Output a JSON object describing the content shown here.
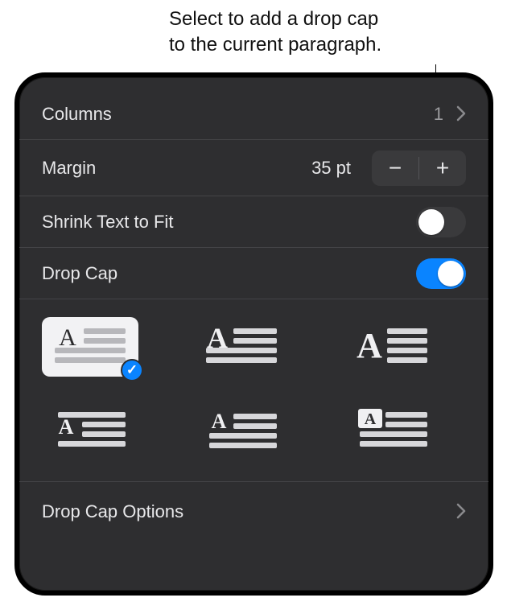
{
  "callout": {
    "line1": "Select to add a drop cap",
    "line2": "to the current paragraph."
  },
  "panel": {
    "columns": {
      "label": "Columns",
      "value": "1"
    },
    "margin": {
      "label": "Margin",
      "value": "35 pt",
      "decrease_glyph": "−",
      "increase_glyph": "+"
    },
    "shrink": {
      "label": "Shrink Text to Fit",
      "enabled": false
    },
    "dropcap": {
      "label": "Drop Cap",
      "enabled": true
    },
    "styles": {
      "selected_index": 0,
      "items": [
        {
          "name": "raised-two-line"
        },
        {
          "name": "large-sit-above"
        },
        {
          "name": "large-beside"
        },
        {
          "name": "small-centered"
        },
        {
          "name": "inline"
        },
        {
          "name": "boxed"
        }
      ]
    },
    "options_label": "Drop Cap Options"
  }
}
